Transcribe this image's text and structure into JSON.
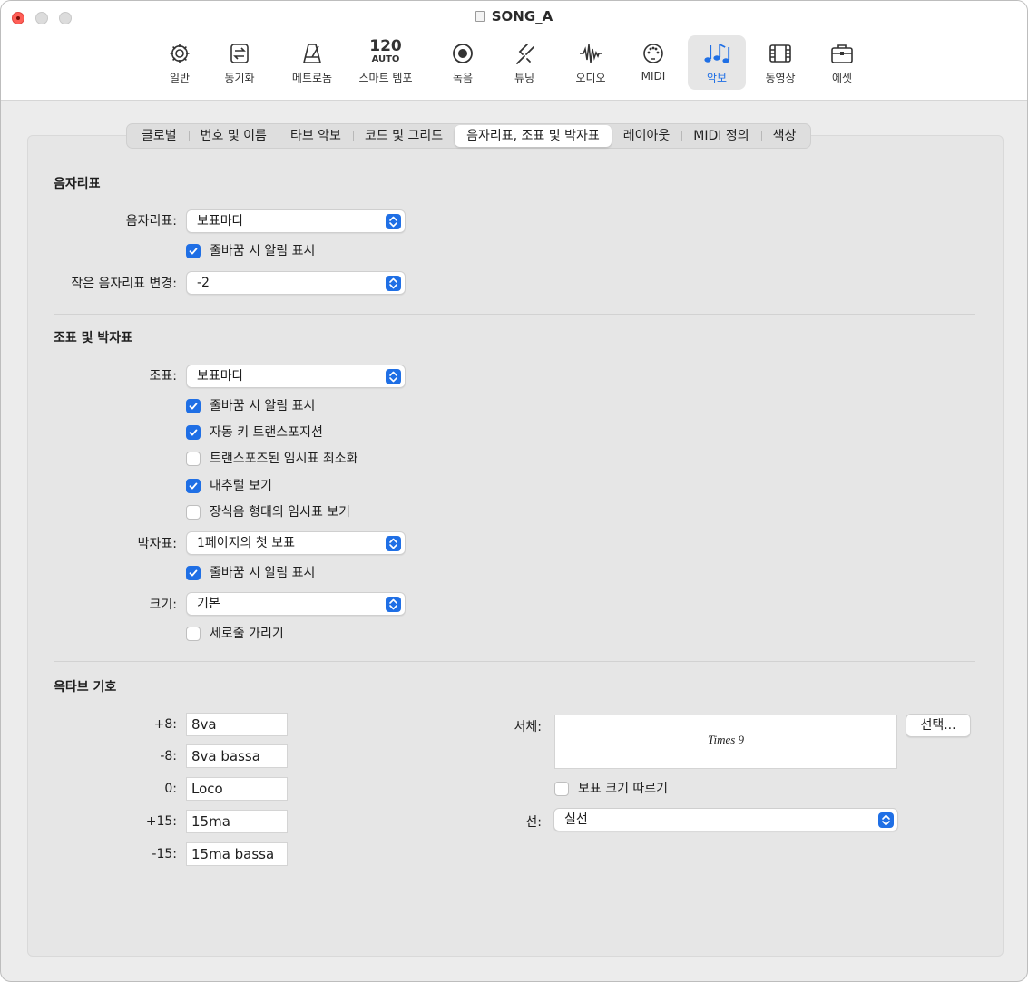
{
  "window": {
    "title": "SONG_A"
  },
  "toolbar": {
    "items": [
      {
        "label": "일반",
        "icon": "gear-icon"
      },
      {
        "label": "동기화",
        "icon": "sync-icon"
      },
      {
        "label": "메트로놈",
        "icon": "metronome-icon"
      },
      {
        "label": "스마트 템포",
        "icon": "smart-tempo-icon",
        "tempo": "120",
        "mode": "AUTO"
      },
      {
        "label": "녹음",
        "icon": "record-icon"
      },
      {
        "label": "튜닝",
        "icon": "tuning-fork-icon"
      },
      {
        "label": "오디오",
        "icon": "waveform-icon"
      },
      {
        "label": "MIDI",
        "icon": "midi-icon"
      },
      {
        "label": "악보",
        "icon": "score-notes-icon",
        "active": true
      },
      {
        "label": "동영상",
        "icon": "film-icon"
      },
      {
        "label": "에셋",
        "icon": "briefcase-icon"
      }
    ]
  },
  "tabs": [
    {
      "label": "글로벌"
    },
    {
      "label": "번호 및 이름"
    },
    {
      "label": "타브 악보"
    },
    {
      "label": "코드 및 그리드"
    },
    {
      "label": "음자리표, 조표 및 박자표",
      "active": true
    },
    {
      "label": "레이아웃"
    },
    {
      "label": "MIDI 정의"
    },
    {
      "label": "색상"
    }
  ],
  "clef": {
    "title": "음자리표",
    "clef_label": "음자리표:",
    "clef_value": "보표마다",
    "clef_alert": {
      "label": "줄바꿈 시 알림 표시",
      "checked": true
    },
    "small_change_label": "작은 음자리표 변경:",
    "small_change_value": "-2"
  },
  "key_time": {
    "title": "조표 및 박자표",
    "key_label": "조표:",
    "key_value": "보표마다",
    "key_alert": {
      "label": "줄바꿈 시 알림 표시",
      "checked": true
    },
    "auto_transpose": {
      "label": "자동 키 트랜스포지션",
      "checked": true
    },
    "minimize_accidentals": {
      "label": "트랜스포즈된 임시표 최소화",
      "checked": false
    },
    "show_naturals": {
      "label": "내추럴 보기",
      "checked": true
    },
    "ornament_accidentals": {
      "label": "장식음 형태의 임시표 보기",
      "checked": false
    },
    "time_label": "박자표:",
    "time_value": "1페이지의 첫 보표",
    "time_alert": {
      "label": "줄바꿈 시 알림 표시",
      "checked": true
    },
    "size_label": "크기:",
    "size_value": "기본",
    "hide_barlines": {
      "label": "세로줄 가리기",
      "checked": false
    }
  },
  "octave": {
    "title": "옥타브 기호",
    "rows": [
      {
        "label": "+8:",
        "value": "8va"
      },
      {
        "label": "-8:",
        "value": "8va bassa"
      },
      {
        "label": "0:",
        "value": "Loco"
      },
      {
        "label": "+15:",
        "value": "15ma"
      },
      {
        "label": "-15:",
        "value": "15ma bassa"
      }
    ],
    "font_label": "서체:",
    "font_preview": "Times 9",
    "choose_button": "선택...",
    "follow_staff_size": {
      "label": "보표 크기 따르기",
      "checked": false
    },
    "line_label": "선:",
    "line_value": "실선"
  },
  "colors": {
    "accent": "#1f6fe5",
    "close": "#ff5f57"
  }
}
